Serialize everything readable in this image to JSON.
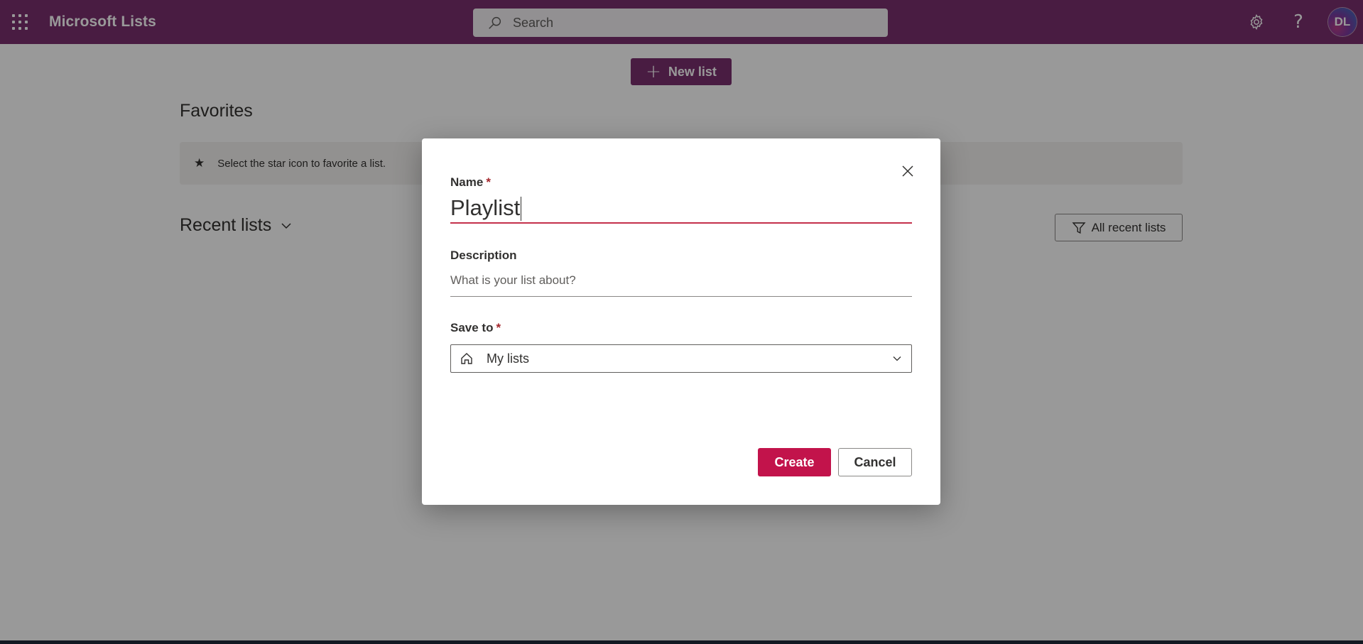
{
  "header": {
    "app_title": "Microsoft Lists",
    "search_placeholder": "Search",
    "avatar_initials": "DL",
    "help_glyph": "?",
    "brand_color": "#7a2f6e",
    "icons": [
      "app-launcher-icon",
      "search-icon",
      "gear-icon",
      "help-icon"
    ]
  },
  "main": {
    "new_list_label": "New list",
    "favorites_title": "Favorites",
    "favorites_hint": "Select the star icon to favorite a list.",
    "recent_title": "Recent lists",
    "recent_filter_label": "All recent lists"
  },
  "dialog": {
    "name_label": "Name",
    "required_mark": "*",
    "name_value": "Playlist",
    "description_label": "Description",
    "description_placeholder": "What is your list about?",
    "save_to_label": "Save to",
    "save_to_value": "My lists",
    "create_label": "Create",
    "cancel_label": "Cancel",
    "accent_color": "#c2134b"
  }
}
